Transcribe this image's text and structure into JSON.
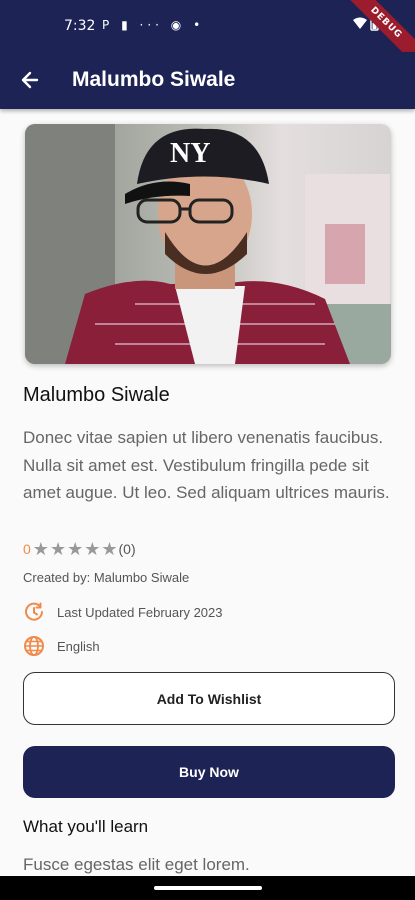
{
  "status_bar": {
    "time": "7:32",
    "notification_icons": [
      "P",
      "▮",
      "···",
      "◉",
      "•"
    ],
    "debug_label": "DEBUG"
  },
  "app_bar": {
    "title": "Malumbo Siwale",
    "back_icon": "arrow-left-icon"
  },
  "course": {
    "name": "Malumbo Siwale",
    "description": "Donec vitae sapien ut libero venenatis faucibus. Nulla sit amet est. Vestibulum fringilla pede sit amet augue. Ut leo. Sed aliquam ultrices mauris.",
    "rating_value": "0",
    "rating_stars": 0,
    "rating_count": "(0)",
    "created_by": "Created by: Malumbo Siwale",
    "last_updated": "Last Updated February 2023",
    "language": "English"
  },
  "buttons": {
    "wishlist": "Add To Wishlist",
    "buy": "Buy Now"
  },
  "learn": {
    "title": "What you'll learn",
    "first_item": "Fusce egestas elit eget lorem."
  },
  "colors": {
    "primary": "#1d2455",
    "accent": "#f08a4b"
  }
}
